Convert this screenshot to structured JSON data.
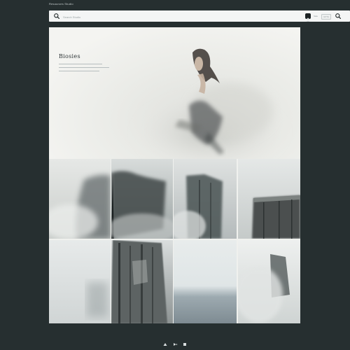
{
  "window": {
    "title": "Resources Studio"
  },
  "search": {
    "placeholder": "Search Studio"
  },
  "header_chips": {
    "count_label": "Sale",
    "tag_label": "GPTA"
  },
  "hero": {
    "title": "Biosies"
  },
  "icons": {
    "search": "search-icon",
    "avatar": "avatar-icon",
    "prev": "triangle-up-icon",
    "play": "play-icon",
    "stop": "stop-icon"
  },
  "colors": {
    "background": "#262f30",
    "canvas": "#f0f1ee",
    "searchbar": "#f4f5f5",
    "control_white": "#d9dedf"
  },
  "gallery": {
    "rows": 2,
    "columns": 4,
    "tiles": [
      {
        "name": "tile-fog-ridge",
        "tone": "#c9cdca"
      },
      {
        "name": "tile-dark-cliff",
        "tone": "#8a9394"
      },
      {
        "name": "tile-cliff-face",
        "tone": "#7d8788"
      },
      {
        "name": "tile-rock-ledge",
        "tone": "#a8aeac"
      },
      {
        "name": "tile-mist",
        "tone": "#dfe3e2"
      },
      {
        "name": "tile-rock-column",
        "tone": "#6b716f"
      },
      {
        "name": "tile-sea-horizon",
        "tone": "#c4cdd0"
      },
      {
        "name": "tile-fog-rock",
        "tone": "#c9cdcb"
      }
    ]
  }
}
